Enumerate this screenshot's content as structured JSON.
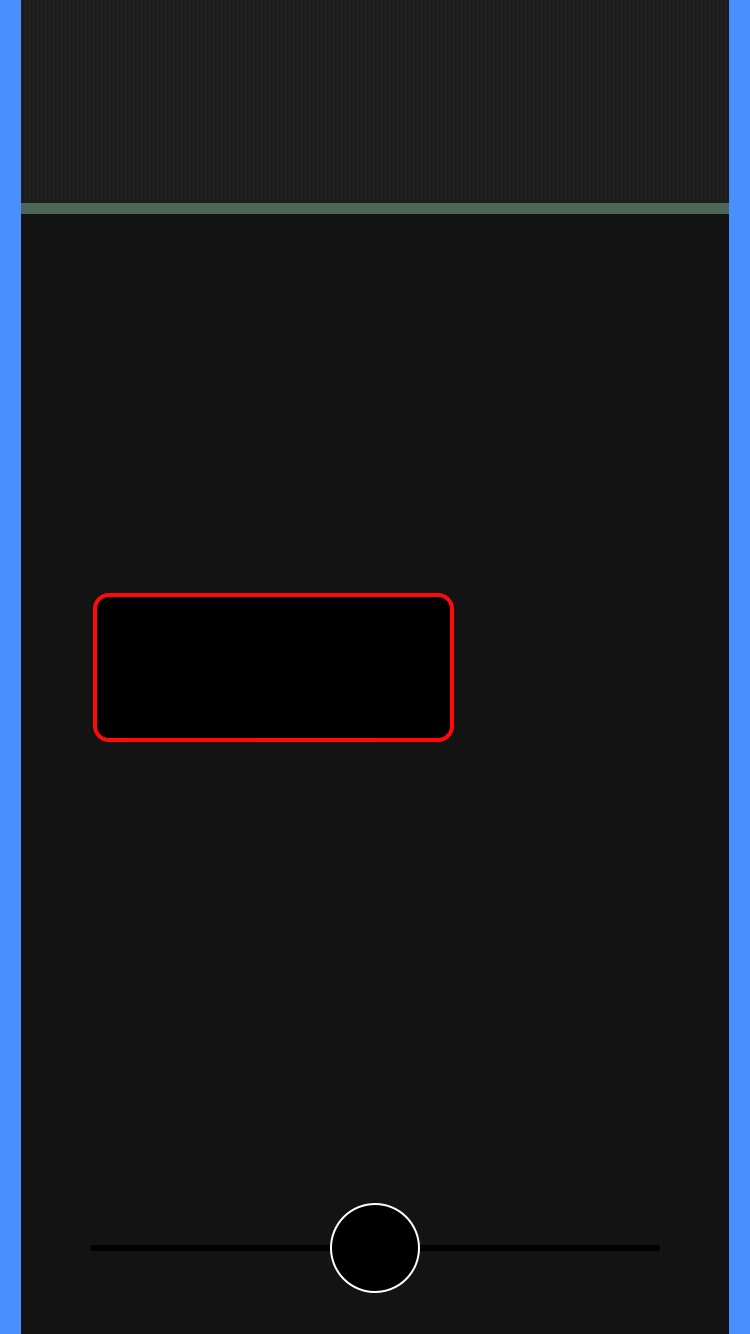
{
  "colors": {
    "frame_background": "#4a8ffe",
    "screen_background": "#121212",
    "top_panel_background": "#1c1c1c",
    "header_divider": "#4e6658",
    "selection_border": "#ff0a0a",
    "selection_fill": "#000000",
    "slider_track": "#000000",
    "slider_thumb_fill": "#000000",
    "slider_thumb_border": "#ffffff"
  },
  "slider": {
    "level": 0.5
  }
}
